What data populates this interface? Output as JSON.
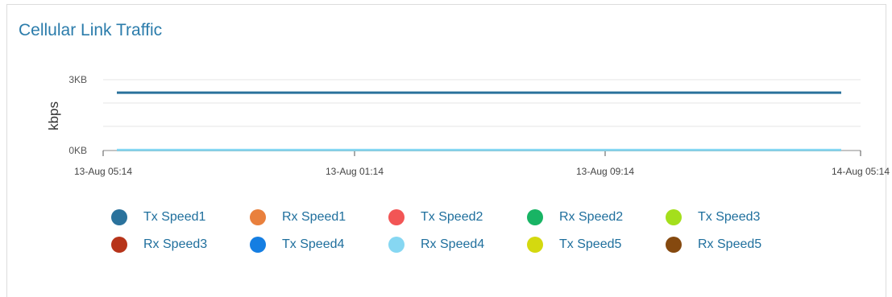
{
  "panel": {
    "title": "Cellular Link Traffic"
  },
  "chart_data": {
    "type": "line",
    "ylabel": "kbps",
    "xlabel": "",
    "y_ticks": [
      "0KB",
      "3KB"
    ],
    "x_ticks": [
      "13-Aug 05:14",
      "13-Aug 01:14",
      "13-Aug 09:14",
      "14-Aug 05:14"
    ],
    "ylim": [
      0,
      3
    ],
    "y_unit": "KB",
    "grid": true,
    "legend_position": "bottom",
    "series": [
      {
        "name": "Tx Speed1",
        "color": "#2a729c",
        "values": [
          2.45,
          2.45
        ]
      },
      {
        "name": "Rx Speed1",
        "color": "#e9803d",
        "values": [
          0,
          0
        ]
      },
      {
        "name": "Tx Speed2",
        "color": "#f25555",
        "values": [
          0,
          0
        ]
      },
      {
        "name": "Rx Speed2",
        "color": "#18b464",
        "values": [
          0,
          0
        ]
      },
      {
        "name": "Tx Speed3",
        "color": "#a4df1c",
        "values": [
          0,
          0
        ]
      },
      {
        "name": "Rx Speed3",
        "color": "#b7341a",
        "values": [
          0,
          0
        ]
      },
      {
        "name": "Tx Speed4",
        "color": "#157ee2",
        "values": [
          0,
          0
        ]
      },
      {
        "name": "Rx Speed4",
        "color": "#86d7f2",
        "values": [
          0.02,
          0.02
        ]
      },
      {
        "name": "Tx Speed5",
        "color": "#d4d90f",
        "values": [
          0,
          0
        ]
      },
      {
        "name": "Rx Speed5",
        "color": "#85490f",
        "values": [
          0,
          0
        ]
      }
    ]
  }
}
